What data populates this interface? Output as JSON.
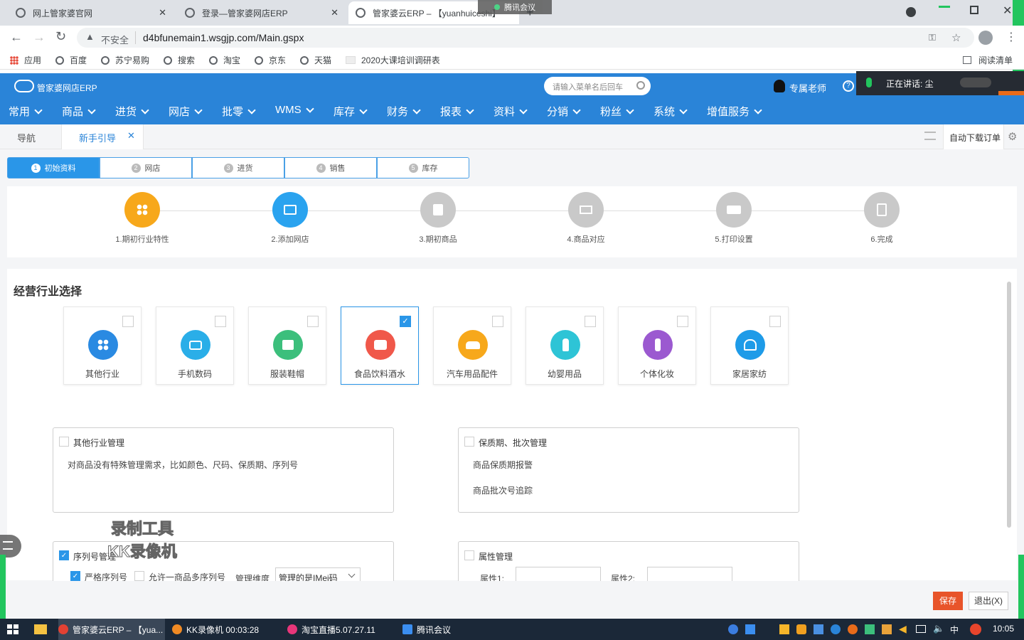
{
  "browser": {
    "tabs": [
      {
        "title": "网上管家婆官网"
      },
      {
        "title": "登录—管家婆网店ERP"
      },
      {
        "title": "管家婆云ERP – 【yuanhuiceshi】"
      }
    ],
    "tencent_overlay": "腾讯会议",
    "security": "不安全",
    "url": "d4bfunemain1.wsgjp.com/Main.gspx",
    "bookmarks": [
      "应用",
      "百度",
      "苏宁易购",
      "搜索",
      "淘宝",
      "京东",
      "天猫",
      "2020大课培训调研表"
    ],
    "reading_list": "阅读清单"
  },
  "meeting_overlay": {
    "speaking": "正在讲话: 尘"
  },
  "app": {
    "logo": "管家婆网店ERP",
    "search_placeholder": "请输入菜单名后回车",
    "teacher": "专属老师",
    "menus": [
      "常用",
      "商品",
      "进货",
      "网店",
      "批零",
      "WMS",
      "库存",
      "财务",
      "报表",
      "资料",
      "分销",
      "粉丝",
      "系统",
      "增值服务"
    ],
    "nav_tab": "导航",
    "active_tab": "新手引导",
    "auto_download": "自动下载订单"
  },
  "steps": [
    {
      "num": "1",
      "label": "初始资料",
      "active": true
    },
    {
      "num": "2",
      "label": "网店",
      "active": false
    },
    {
      "num": "3",
      "label": "进货",
      "active": false
    },
    {
      "num": "4",
      "label": "销售",
      "active": false
    },
    {
      "num": "5",
      "label": "库存",
      "active": false
    }
  ],
  "flow": [
    {
      "label": "1.期初行业特性",
      "color": "#f7a81b",
      "icon": "grid-icon"
    },
    {
      "label": "2.添加网店",
      "color": "#2aa3ef",
      "icon": "shop-icon"
    },
    {
      "label": "3.期初商品",
      "color": "#c9c9c9",
      "icon": "goods-icon"
    },
    {
      "label": "4.商品对应",
      "color": "#c9c9c9",
      "icon": "match-icon"
    },
    {
      "label": "5.打印设置",
      "color": "#c9c9c9",
      "icon": "printer-icon"
    },
    {
      "label": "6.完成",
      "color": "#c9c9c9",
      "icon": "done-icon"
    }
  ],
  "section_title": "经营行业选择",
  "industries": [
    {
      "label": "其他行业",
      "color": "#2a8ae2",
      "selected": false,
      "icon": "grid-icon"
    },
    {
      "label": "手机数码",
      "color": "#2aaee8",
      "selected": false,
      "icon": "camera-icon"
    },
    {
      "label": "服装鞋帽",
      "color": "#3cbf7c",
      "selected": false,
      "icon": "shirt-icon"
    },
    {
      "label": "食品饮料酒水",
      "color": "#f0584a",
      "selected": true,
      "icon": "food-icon"
    },
    {
      "label": "汽车用品配件",
      "color": "#f7a81b",
      "selected": false,
      "icon": "car-icon"
    },
    {
      "label": "幼婴用品",
      "color": "#2ec4d6",
      "selected": false,
      "icon": "bottle-icon"
    },
    {
      "label": "个体化妆",
      "color": "#9b59d0",
      "selected": false,
      "icon": "cosmetic-icon"
    },
    {
      "label": "家居家纺",
      "color": "#1e9be8",
      "selected": false,
      "icon": "home-icon"
    }
  ],
  "panels": {
    "other": {
      "title": "其他行业管理",
      "desc": "对商品没有特殊管理需求，比如颜色、尺码、保质期、序列号"
    },
    "shelf": {
      "title": "保质期、批次管理",
      "items": [
        "商品保质期报警",
        "商品批次号追踪"
      ]
    },
    "serial": {
      "title": "序列号管理",
      "strict": "严格序列号",
      "allow_multi": "允许一商品多序列号",
      "dimension_label": "管理维度",
      "dimension_value": "管理的是IMei码"
    },
    "attr": {
      "title": "属性管理",
      "attr1": "属性1:",
      "attr2": "属性2:"
    }
  },
  "watermark": {
    "line1": "录制工具",
    "line2": "KK录像机"
  },
  "buttons": {
    "save": "保存",
    "exit": "退出(X)"
  },
  "taskbar": {
    "items": [
      "管家婆云ERP – 【yua...",
      "KK录像机 00:03:28",
      "淘宝直播5.07.27.11",
      "腾讯会议"
    ],
    "ime": "中",
    "time": "10:05"
  }
}
